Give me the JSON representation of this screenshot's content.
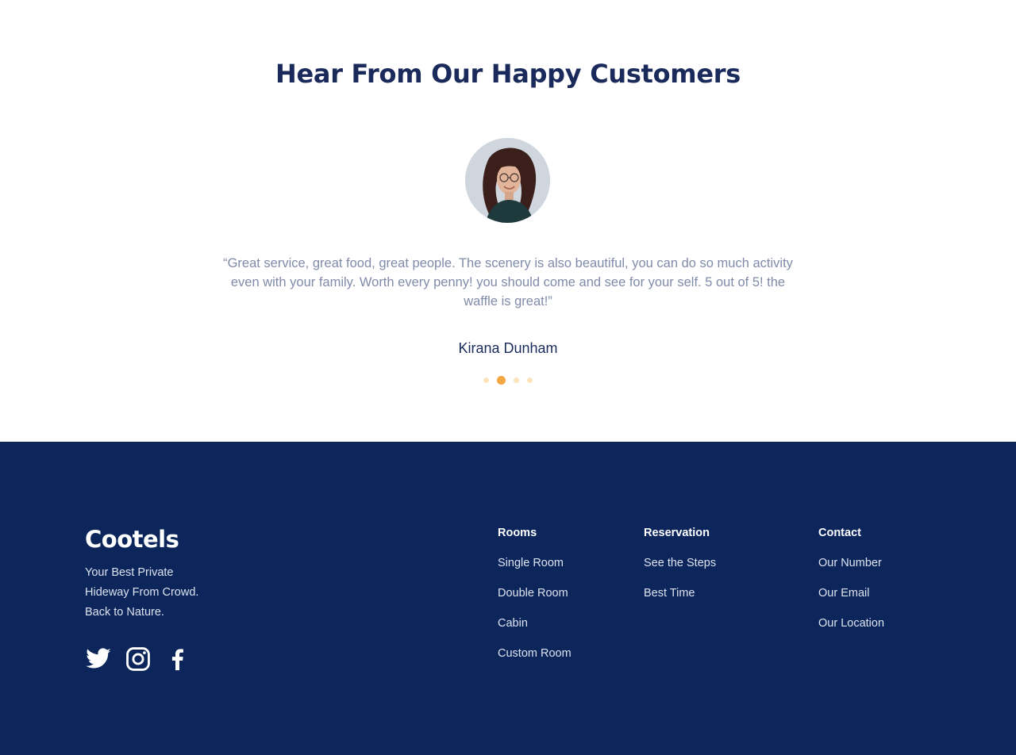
{
  "testimonials": {
    "title": "Hear From Our Happy Customers",
    "quote": "“Great service, great food, great people. The scenery is also beautiful, you can do so much activity even with your family. Worth every penny! you should come and see for your self.  5 out of 5! the waffle is great!”",
    "author": "Kirana Dunham",
    "pagination": {
      "total": 4,
      "active_index": 1
    }
  },
  "footer": {
    "brand": "Cootels",
    "tagline": [
      "Your Best Private",
      "Hideway From Crowd.",
      "Back to Nature."
    ],
    "social": [
      "twitter-icon",
      "instagram-icon",
      "facebook-icon"
    ],
    "columns": [
      {
        "title": "Rooms",
        "links": [
          "Single Room",
          "Double Room",
          "Cabin",
          "Custom Room"
        ]
      },
      {
        "title": "Reservation",
        "links": [
          "See the Steps",
          "Best Time"
        ]
      },
      {
        "title": "Contact",
        "links": [
          "Our Number",
          "Our Email",
          "Our Location"
        ]
      }
    ]
  },
  "colors": {
    "heading": "#1a2a5a",
    "quote_text": "#7f8ba8",
    "footer_bg": "#0c265c",
    "dot_active": "#f4a640",
    "dot_inactive": "#fde3bb"
  }
}
